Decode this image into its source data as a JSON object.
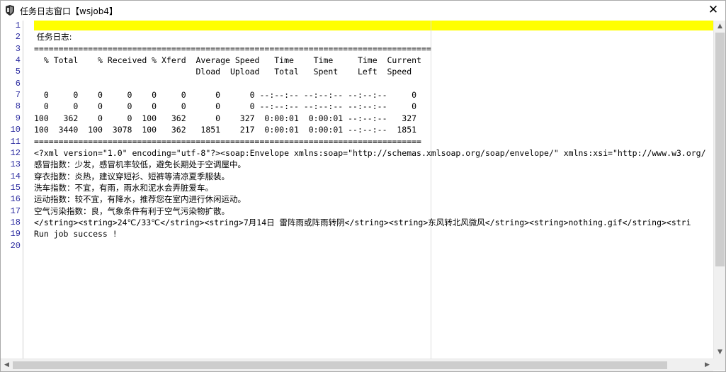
{
  "window": {
    "title": "任务日志窗口【wsjob4】",
    "close_symbol": "✕"
  },
  "editor": {
    "line_numbers": [
      "1",
      "2",
      "3",
      "4",
      "5",
      "6",
      "7",
      "8",
      "9",
      "10",
      "11",
      "12",
      "13",
      "14",
      "15",
      "16",
      "17",
      "18",
      "19",
      "20"
    ],
    "lines": [
      "",
      " 任务日志:",
      "=================================================================================",
      "  % Total    % Received % Xferd  Average Speed   Time    Time     Time  Current",
      "                                 Dload  Upload   Total   Spent    Left  Speed",
      "",
      "  0     0    0     0    0     0      0      0 --:--:-- --:--:-- --:--:--     0",
      "  0     0    0     0    0     0      0      0 --:--:-- --:--:-- --:--:--     0",
      "100   362    0     0  100   362      0    327  0:00:01  0:00:01 --:--:--   327",
      "100  3440  100  3078  100   362   1851    217  0:00:01  0:00:01 --:--:--  1851",
      "===============================================================================",
      "<?xml version=\"1.0\" encoding=\"utf-8\"?><soap:Envelope xmlns:soap=\"http://schemas.xmlsoap.org/soap/envelope/\" xmlns:xsi=\"http://www.w3.org/",
      "感冒指数：少发，感冒机率较低，避免长期处于空调屋中。",
      "穿衣指数：炎热，建议穿短衫、短裤等清凉夏季服装。",
      "洗车指数：不宜，有雨，雨水和泥水会弄脏爱车。",
      "运动指数：较不宜，有降水，推荐您在室内进行休闲运动。",
      "空气污染指数：良，气象条件有利于空气污染物扩散。",
      "</string><string>24℃/33℃</string><string>7月14日 雷阵雨或阵雨转阴</string><string>东风转北风微风</string><string>nothing.gif</string><stri",
      "Run job success !",
      ""
    ],
    "highlight_color": "#ffff00"
  },
  "scrollbars": {
    "up_arrow": "▲",
    "down_arrow": "▼",
    "left_arrow": "◀",
    "right_arrow": "▶"
  }
}
